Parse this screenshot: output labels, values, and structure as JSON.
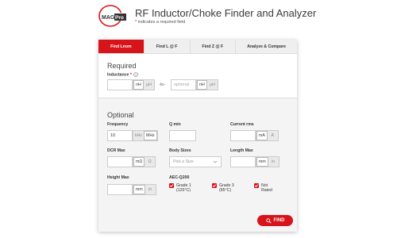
{
  "header": {
    "logo_text": "MAGPro",
    "title": "RF Inductor/Choke Finder and Analyzer",
    "required_star": "*",
    "required_note": "indicates a required field"
  },
  "tabs": [
    {
      "label": "Find Lnom",
      "active": true
    },
    {
      "label": "Find L @ F",
      "active": false
    },
    {
      "label": "Find Z @ F",
      "active": false
    },
    {
      "label": "Analyze & Compare",
      "active": false
    }
  ],
  "required": {
    "title": "Required",
    "inductance": {
      "label": "Inductance",
      "star": "*",
      "icon": "info-icon",
      "value": "",
      "units": [
        "nH",
        "µH"
      ],
      "to_label": "-to-",
      "max_placeholder": "optional",
      "max_units": [
        "nH",
        "µH"
      ]
    }
  },
  "optional": {
    "title": "Optional",
    "frequency": {
      "label": "Frequency",
      "value": "10",
      "units": [
        "kHz",
        "MHz"
      ]
    },
    "q_min": {
      "label": "Q min",
      "value": ""
    },
    "current_rms": {
      "label": "Current rms",
      "value": "",
      "units": [
        "mA",
        "A"
      ]
    },
    "dcr_max": {
      "label": "DCR Max",
      "value": "",
      "units": [
        "mΩ",
        "Ω"
      ]
    },
    "body_sizes": {
      "label": "Body Sizes",
      "placeholder": "Pick a Size"
    },
    "length_max": {
      "label": "Length Max",
      "value": "",
      "units": [
        "mm",
        "in"
      ]
    },
    "height_max": {
      "label": "Height Max",
      "value": "",
      "units": [
        "mm",
        "in"
      ]
    },
    "aec": {
      "label": "AEC-Q200",
      "options": [
        {
          "line1": "Grade 1",
          "line2": "(125°C)",
          "checked": true
        },
        {
          "line1": "Grade 3",
          "line2": "(85°C)",
          "checked": true
        },
        {
          "line1": "Not",
          "line2": "Rated",
          "checked": true
        }
      ]
    }
  },
  "find_button": {
    "label": "FIND",
    "icon": "search-icon"
  },
  "colors": {
    "accent": "#d7141a",
    "panel_bg": "#f4f4f4"
  }
}
